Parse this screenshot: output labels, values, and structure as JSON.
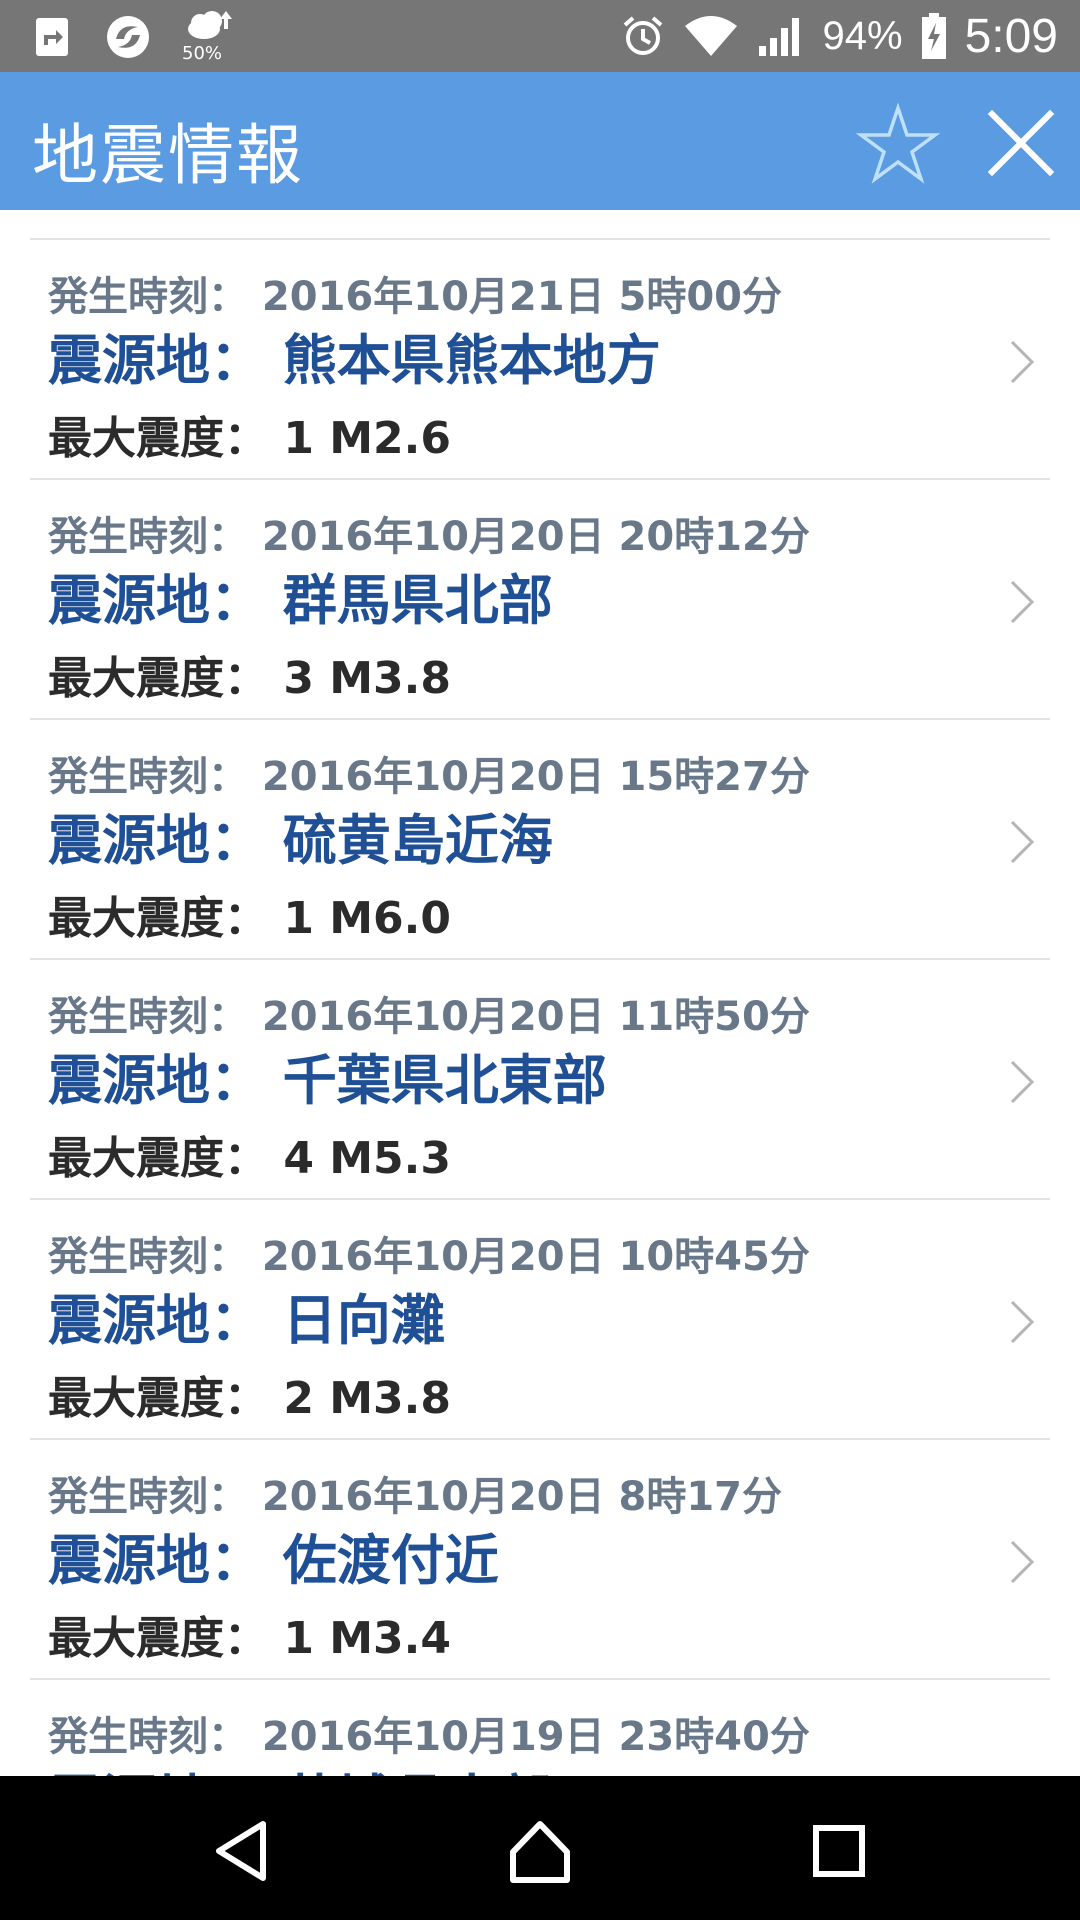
{
  "status_bar": {
    "weather_text": "50%",
    "battery": "94%",
    "time": "5:09",
    "icons": [
      "app-shortcut-icon",
      "sync-icon",
      "weather-icon",
      "alarm-icon",
      "wifi-icon",
      "signal-icon",
      "battery-charging-icon"
    ]
  },
  "app_bar": {
    "title": "地震情報",
    "star_icon": "star-outline-icon",
    "close_icon": "close-icon",
    "color": "#5a9be2"
  },
  "list": {
    "items": [
      {
        "time": "発生時刻： 2016年10月21日 5時00分",
        "epicenter": "震源地： 熊本県熊本地方",
        "intensity": "最大震度： 1  M2.6"
      },
      {
        "time": "発生時刻： 2016年10月20日 20時12分",
        "epicenter": "震源地： 群馬県北部",
        "intensity": "最大震度： 3  M3.8"
      },
      {
        "time": "発生時刻： 2016年10月20日 15時27分",
        "epicenter": "震源地： 硫黄島近海",
        "intensity": "最大震度： 1  M6.0"
      },
      {
        "time": "発生時刻： 2016年10月20日 11時50分",
        "epicenter": "震源地： 千葉県北東部",
        "intensity": "最大震度： 4  M5.3"
      },
      {
        "time": "発生時刻： 2016年10月20日 10時45分",
        "epicenter": "震源地： 日向灘",
        "intensity": "最大震度： 2  M3.8"
      },
      {
        "time": "発生時刻： 2016年10月20日 8時17分",
        "epicenter": "震源地： 佐渡付近",
        "intensity": "最大震度： 1  M3.4"
      },
      {
        "time": "発生時刻： 2016年10月19日 23時40分",
        "epicenter": "震源地： 茨城県南部",
        "intensity": ""
      }
    ]
  },
  "nav_bar": {
    "icons": [
      "back-icon",
      "home-icon",
      "recents-icon"
    ]
  }
}
